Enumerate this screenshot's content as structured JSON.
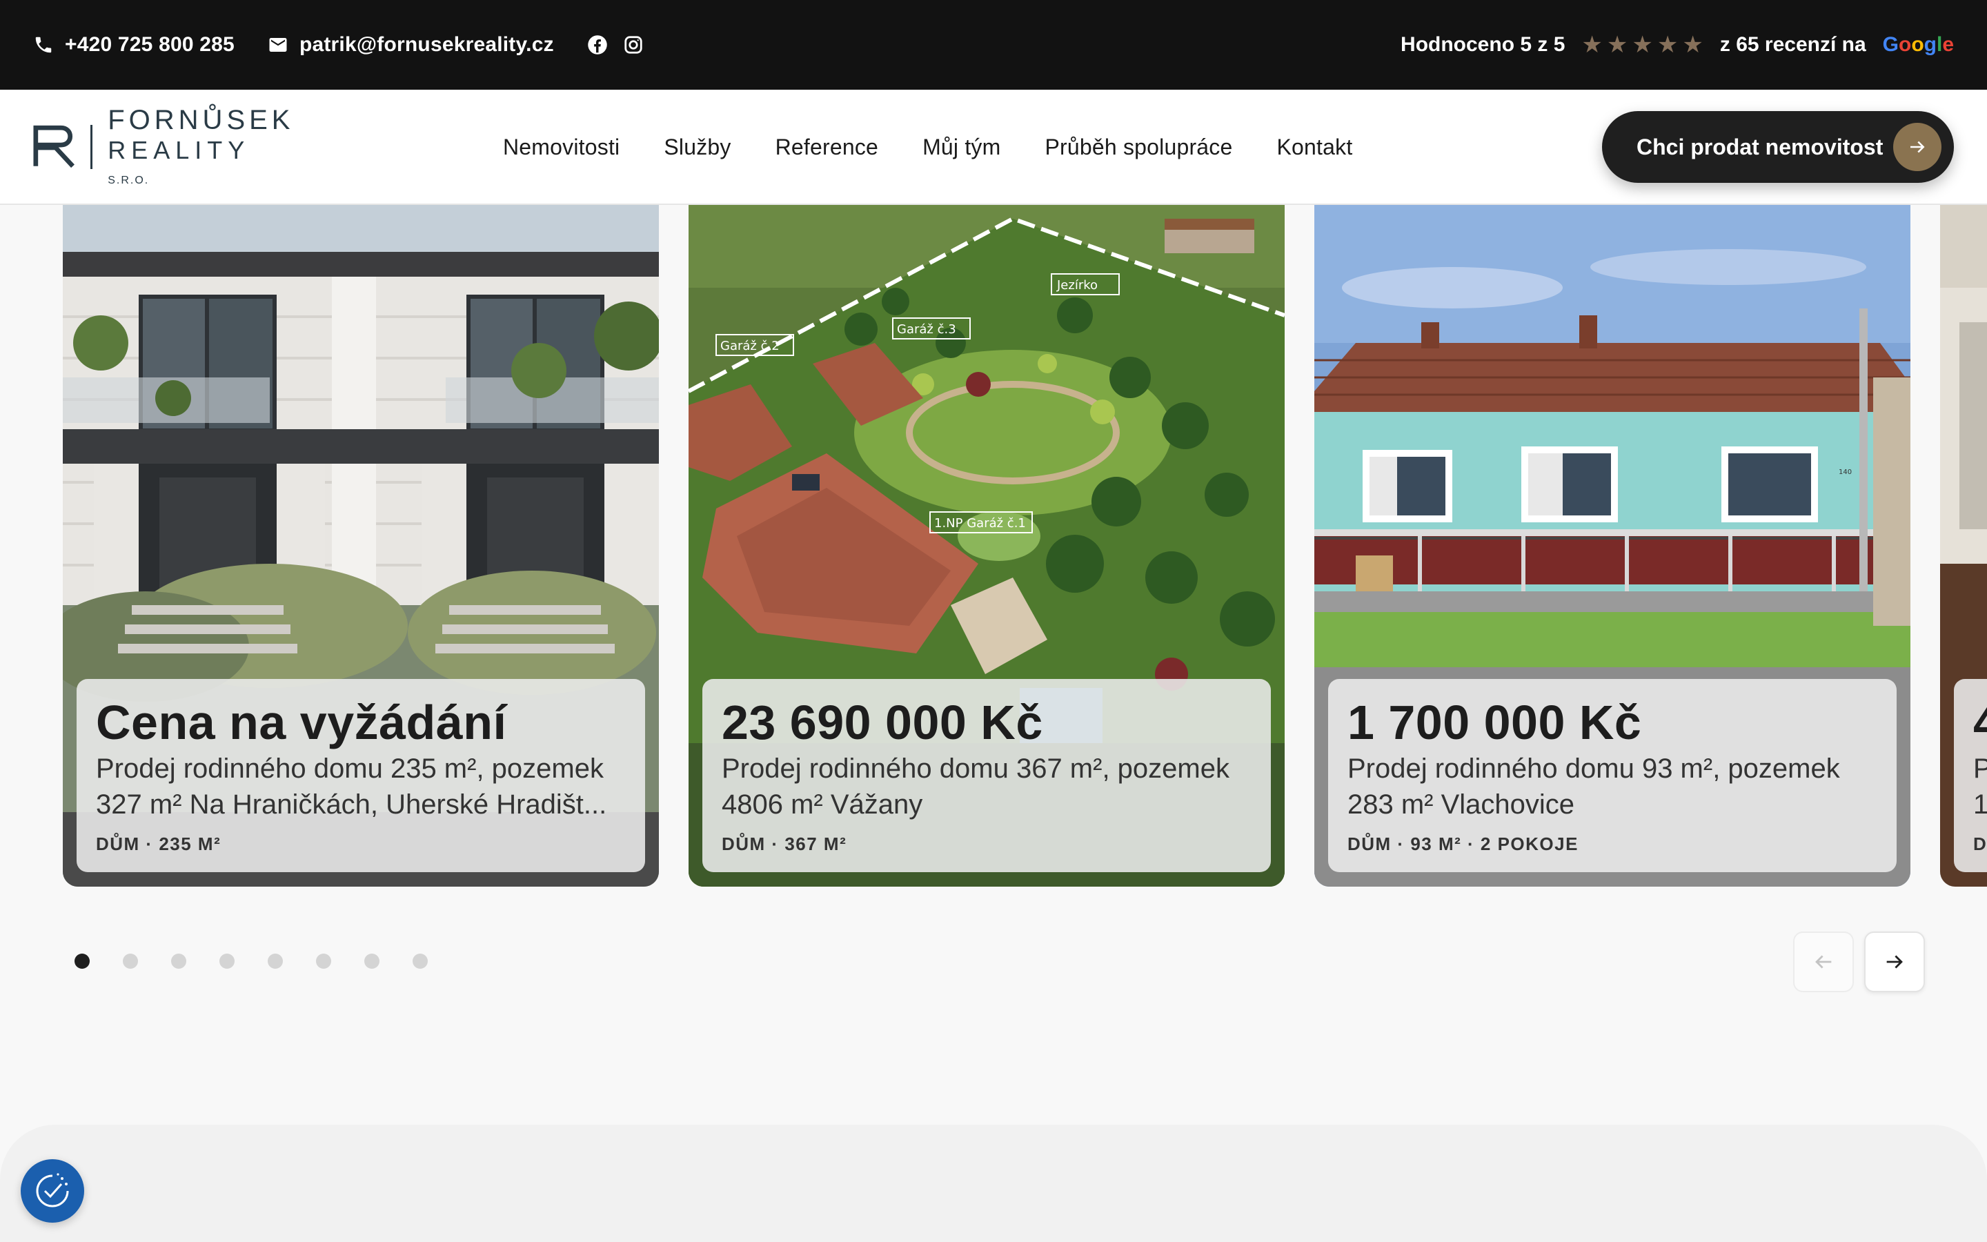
{
  "topbar": {
    "phone": "+420 725 800 285",
    "email": "patrik@fornusekreality.cz",
    "rating_prefix": "Hodnoceno",
    "rating_value": "5 z 5",
    "reviews_prefix": "z",
    "reviews_count": "65",
    "reviews_suffix": "recenzí na",
    "google_letters": [
      "G",
      "o",
      "o",
      "g",
      "l",
      "e"
    ],
    "stars": 5,
    "star_color": "#86705a"
  },
  "logo": {
    "line1": "FORNŮSEK",
    "line2": "REALITY",
    "suffix": "S.R.O."
  },
  "nav": {
    "items": [
      "Nemovitosti",
      "Služby",
      "Reference",
      "Můj tým",
      "Průběh spolupráce",
      "Kontakt"
    ],
    "cta_label": "Chci prodat nemovitost",
    "cta_accent": "#8a7350"
  },
  "listings": [
    {
      "price": "Cena na vyžádání",
      "desc_line1": "Prodej rodinného domu 235 m², pozemek",
      "desc_line2": "327 m² Na Hraničkách, Uherské Hradišt...",
      "meta": "DŮM · 235 M²"
    },
    {
      "price": "23 690 000 Kč",
      "desc_line1": "Prodej rodinného domu 367 m², pozemek",
      "desc_line2": "4806 m² Vážany",
      "meta": "DŮM · 367 M²",
      "photo_labels": [
        "Garáž č.2",
        "Garáž č.3",
        "Jezírko",
        "1.NP Garáž č.1"
      ]
    },
    {
      "price": "1 700 000 Kč",
      "desc_line1": "Prodej rodinného domu 93 m², pozemek",
      "desc_line2": "283 m² Vlachovice",
      "meta": "DŮM · 93 M² · 2 POKOJE",
      "photo_labels": [
        "140"
      ]
    },
    {
      "price": "4",
      "desc_line1": "P",
      "desc_line2": "1",
      "meta": "D"
    }
  ],
  "carousel": {
    "dot_count": 8,
    "active_index": 0
  }
}
